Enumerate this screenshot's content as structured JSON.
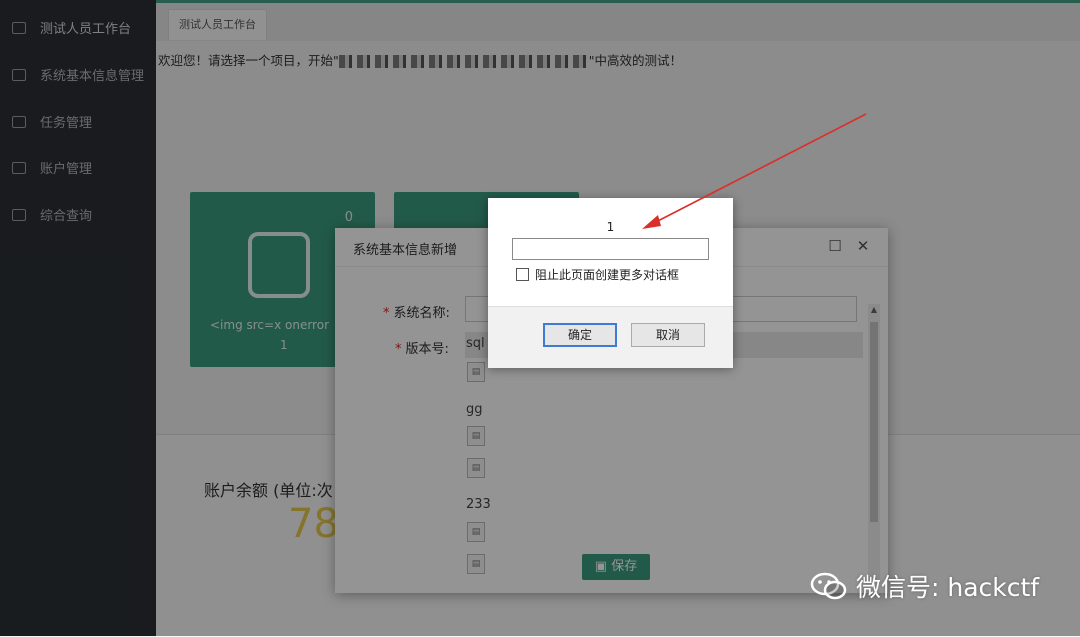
{
  "sidebar": {
    "items": [
      {
        "label": "测试人员工作台",
        "icon": "monitor-icon"
      },
      {
        "label": "系统基本信息管理",
        "icon": "edit-icon"
      },
      {
        "label": "任务管理",
        "icon": "tasks-icon"
      },
      {
        "label": "账户管理",
        "icon": "account-icon"
      },
      {
        "label": "综合查询",
        "icon": "query-icon"
      }
    ]
  },
  "tabs": [
    "测试人员工作台"
  ],
  "welcome": {
    "prefix": "欢迎您！请选择一个项目，开始\"",
    "suffix": "\"中高效的测试！"
  },
  "cards": [
    {
      "count": "0",
      "label": "<img src=x onerror",
      "value": "1"
    }
  ],
  "balance": {
    "label": "账户余额 (单位:次",
    "value": "78"
  },
  "modal": {
    "title": "系统基本信息新增",
    "system_name_label": "系统名称:",
    "version_label": "版本号:",
    "versions": [
      "sql",
      "gg",
      "233"
    ],
    "save_label": "保存"
  },
  "alert": {
    "message": "1",
    "input_value": "",
    "checkbox_label": "阻止此页面创建更多对话框",
    "ok_label": "确定",
    "cancel_label": "取消"
  },
  "watermark": "微信号: hackctf",
  "colors": {
    "accent": "#3c9c7e",
    "arrow": "#d9302a",
    "sidebar": "#2b3034",
    "balance": "#e6c84a"
  }
}
